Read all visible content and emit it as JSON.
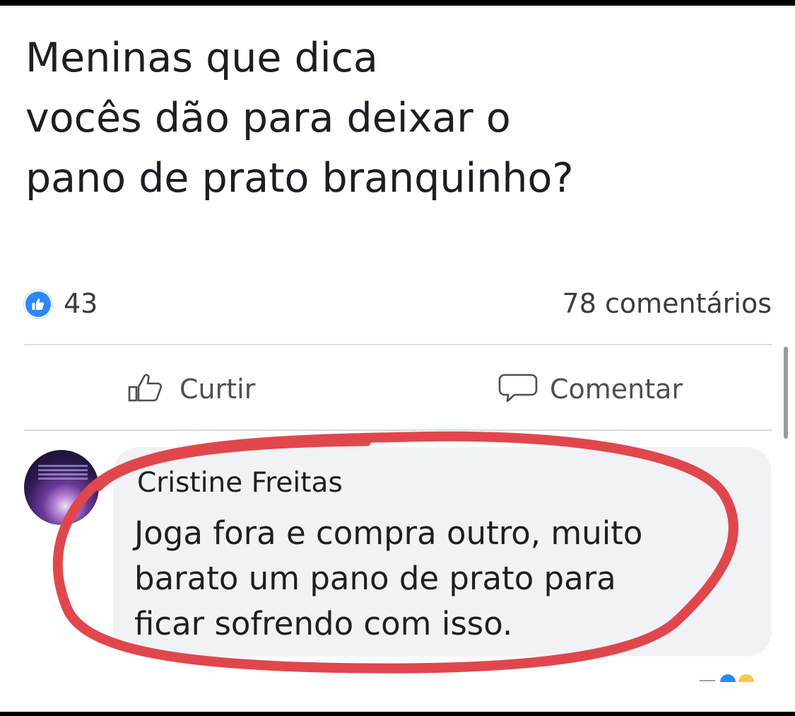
{
  "post": {
    "text_lines": [
      "Meninas que dica",
      "vocês dão para deixar o",
      "pano de prato branquinho?"
    ]
  },
  "stats": {
    "likes": "43",
    "comments": "78 comentários"
  },
  "actions": {
    "like_label": "Curtir",
    "comment_label": "Comentar"
  },
  "comment": {
    "author": "Cristine Freitas",
    "body_lines": [
      "Joga fora e compra outro, muito",
      "barato um pano de prato para",
      "ficar sofrendo com isso."
    ]
  },
  "colors": {
    "like_blue": "#2d88ff",
    "highlight_red": "#e0474c",
    "bubble_bg": "#f0f2f5"
  },
  "icons": {
    "like_badge": "thumbs-up-icon",
    "like_action": "thumbs-up-outline-icon",
    "comment_action": "speech-bubble-icon"
  }
}
